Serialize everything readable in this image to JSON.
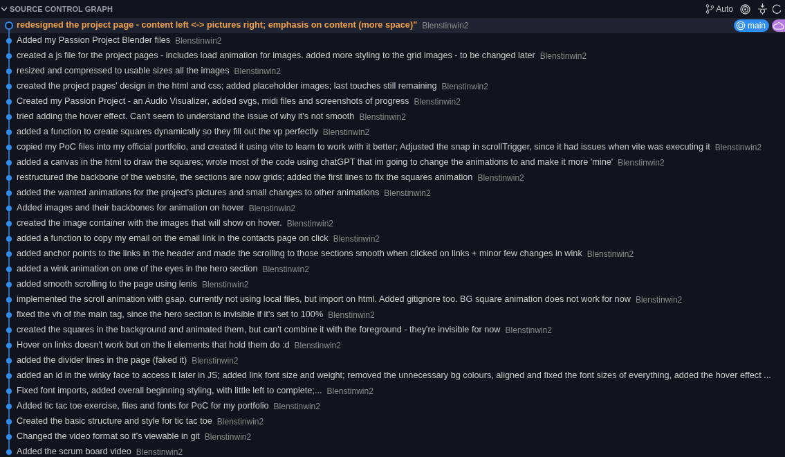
{
  "panel": {
    "title": "SOURCE CONTROL GRAPH",
    "expanded": true,
    "branch_mode": "Auto"
  },
  "commits": [
    {
      "message": "redesigned the project page - content left <-> pictures right; emphasis on content (more space)\"",
      "author": "Blenstinwin2",
      "selected": true,
      "kind": "head",
      "refs": [
        {
          "kind": "branch",
          "label": "main"
        },
        {
          "kind": "remote"
        }
      ]
    },
    {
      "message": "Added my Passion Project Blender files",
      "author": "Blenstinwin2",
      "selected": false,
      "kind": "commit"
    },
    {
      "message": "created a js file for the project pages - includes load animation for images. added more styling to the grid images - to be changed later",
      "author": "Blenstinwin2",
      "selected": false,
      "kind": "commit"
    },
    {
      "message": "resized and compressed to usable sizes all the images",
      "author": "Blenstinwin2",
      "selected": false,
      "kind": "commit"
    },
    {
      "message": "created the project pages' design in the html and css; added placeholder images; last touches still remaining",
      "author": "Blenstinwin2",
      "selected": false,
      "kind": "commit"
    },
    {
      "message": "Created my Passion Project - an Audio Visualizer, added svgs, midi files and screenshots of progress",
      "author": "Blenstinwin2",
      "selected": false,
      "kind": "commit"
    },
    {
      "message": "tried adding the hover effect. Can't seem to understand the issue of why it's not smooth",
      "author": "Blenstinwin2",
      "selected": false,
      "kind": "commit"
    },
    {
      "message": "added a function to create squares dynamically so they fill out the vp perfectly",
      "author": "Blenstinwin2",
      "selected": false,
      "kind": "commit"
    },
    {
      "message": "copied my PoC files into my official portfolio, and created it using vite to learn to work with it better; Adjusted the snap in scrollTrigger, since it had issues when vite was executing it",
      "author": "Blenstinwin2",
      "selected": false,
      "kind": "commit"
    },
    {
      "message": "added a canvas in the html to draw the squares; wrote most of the code using chatGPT that im going to change the animations to and make it more 'mine'",
      "author": "Blenstinwin2",
      "selected": false,
      "kind": "commit"
    },
    {
      "message": "restructured the backbone of the website, the sections are now grids; added the first lines to fix the squares animation",
      "author": "Blenstinwin2",
      "selected": false,
      "kind": "commit"
    },
    {
      "message": "added the wanted animations for the project's pictures and small changes to other animations",
      "author": "Blenstinwin2",
      "selected": false,
      "kind": "commit"
    },
    {
      "message": "Added images and their backbones for animation on hover",
      "author": "Blenstinwin2",
      "selected": false,
      "kind": "commit"
    },
    {
      "message": "created the image container with the images that will show on hover.",
      "author": "Blenstinwin2",
      "selected": false,
      "kind": "commit"
    },
    {
      "message": "added a function to copy my email on the email link in the contacts page on click",
      "author": "Blenstinwin2",
      "selected": false,
      "kind": "commit"
    },
    {
      "message": "added anchor points to the links in the header and made the scrolling to those sections smooth when clicked on links + minor few changes in wink",
      "author": "Blenstinwin2",
      "selected": false,
      "kind": "commit"
    },
    {
      "message": "added a wink animation on one of the eyes in the hero section",
      "author": "Blenstinwin2",
      "selected": false,
      "kind": "commit"
    },
    {
      "message": "added smooth scrolling to the page using lenis",
      "author": "Blenstinwin2",
      "selected": false,
      "kind": "commit"
    },
    {
      "message": "implemented the scroll animation with gsap. currently not using local files, but import on html. Added gitignore too. BG square animation does not work for now",
      "author": "Blenstinwin2",
      "selected": false,
      "kind": "commit"
    },
    {
      "message": "fixed the vh of the main tag, since the hero section is invisible if it's set to 100%",
      "author": "Blenstinwin2",
      "selected": false,
      "kind": "commit"
    },
    {
      "message": "created the squares in the background and animated them, but can't combine it with the foreground - they're invisible for now",
      "author": "Blenstinwin2",
      "selected": false,
      "kind": "commit"
    },
    {
      "message": "Hover on links doesn't work but on the li elements that hold them do :d",
      "author": "Blenstinwin2",
      "selected": false,
      "kind": "commit"
    },
    {
      "message": "added the divider lines in the page (faked it)",
      "author": "Blenstinwin2",
      "selected": false,
      "kind": "commit"
    },
    {
      "message": "added an id in the winky face to access it later in JS; added link font size and weight; removed the unnecessary bg colours, aligned and fixed the font sizes of everything, added the hover effect ...",
      "selected": false,
      "kind": "commit"
    },
    {
      "message": "Fixed font imports, added overall beginning styling, with little left to complete;...",
      "author": "Blenstinwin2",
      "selected": false,
      "kind": "commit"
    },
    {
      "message": "Added tic tac toe exercise, files and fonts for PoC for my portfolio",
      "author": "Blenstinwin2",
      "selected": false,
      "kind": "commit"
    },
    {
      "message": "Created the basic structure and style for tic tac toe",
      "author": "Blenstinwin2",
      "selected": false,
      "kind": "commit"
    },
    {
      "message": "Changed the video format so it's viewable in git",
      "author": "Blenstinwin2",
      "selected": false,
      "kind": "commit"
    },
    {
      "message": "Added the scrum board video",
      "author": "Blenstinwin2",
      "selected": false,
      "kind": "commit"
    }
  ]
}
